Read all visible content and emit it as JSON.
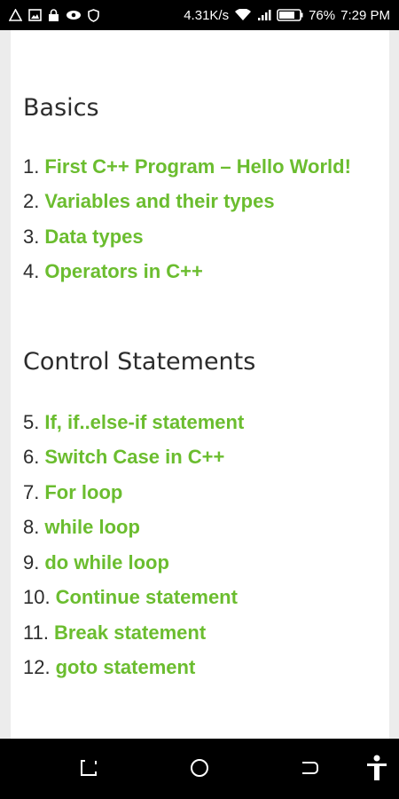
{
  "status_bar": {
    "left_icons": [
      "warning-triangle-icon",
      "image-icon",
      "lock-icon",
      "eye-icon",
      "shield-icon"
    ],
    "net_speed": "4.31K/s",
    "battery_percent": "76%",
    "time": "7:29 PM"
  },
  "sections": [
    {
      "heading": "Basics",
      "items": [
        {
          "num": "1.",
          "label": "First C++ Program – Hello World!"
        },
        {
          "num": "2.",
          "label": "Variables and their types"
        },
        {
          "num": "3.",
          "label": "Data types"
        },
        {
          "num": "4.",
          "label": "Operators in C++"
        }
      ]
    },
    {
      "heading": "Control Statements",
      "items": [
        {
          "num": "5.",
          "label": "If, if..else-if statement"
        },
        {
          "num": "6.",
          "label": "Switch Case in C++"
        },
        {
          "num": "7.",
          "label": "For loop"
        },
        {
          "num": "8.",
          "label": "while loop"
        },
        {
          "num": "9.",
          "label": "do while loop"
        },
        {
          "num": "10.",
          "label": "Continue statement"
        },
        {
          "num": "11.",
          "label": "Break statement"
        },
        {
          "num": "12.",
          "label": "goto statement"
        }
      ]
    }
  ],
  "nav_bar": {
    "buttons": [
      "recent-apps-icon",
      "home-icon",
      "back-icon",
      "accessibility-icon"
    ]
  },
  "colors": {
    "link": "#6bbd2f",
    "heading": "#2c2c2c",
    "background": "#ececec"
  }
}
